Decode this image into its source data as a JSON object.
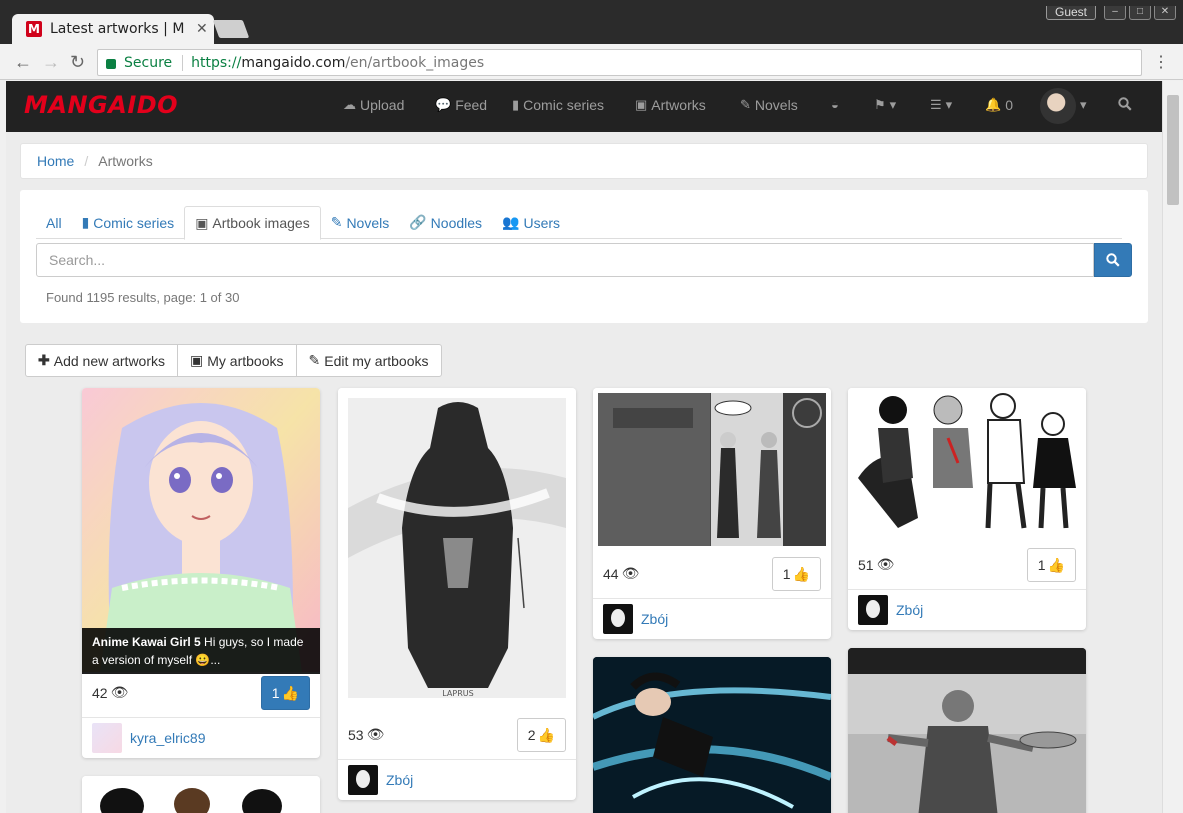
{
  "browser": {
    "tab_title": "Latest artworks | M",
    "tab_favicon": "M",
    "guest_label": "Guest",
    "secure_label": "Secure",
    "url_scheme": "https://",
    "url_host": "mangaido.com",
    "url_path": "/en/artbook_images"
  },
  "site": {
    "logo": "MANGAIDO",
    "nav": [
      {
        "label": "Upload",
        "icon": "cloud-upload-icon"
      },
      {
        "label": "Feed",
        "icon": "comments-icon"
      },
      {
        "label": "Comic series",
        "icon": "book-icon"
      },
      {
        "label": "Artworks",
        "icon": "picture-icon"
      },
      {
        "label": "Novels",
        "icon": "edit-icon"
      }
    ],
    "notif_count": "0",
    "brand_color": "#e3001b",
    "link_color": "#337ab7"
  },
  "breadcrumb": {
    "home": "Home",
    "current": "Artworks"
  },
  "filter_tabs": [
    {
      "label": "All",
      "icon": ""
    },
    {
      "label": "Comic series",
      "icon": "book-icon"
    },
    {
      "label": "Artbook images",
      "icon": "picture-icon"
    },
    {
      "label": "Novels",
      "icon": "edit-icon"
    },
    {
      "label": "Noodles",
      "icon": "link-icon"
    },
    {
      "label": "Users",
      "icon": "users-icon"
    }
  ],
  "search": {
    "placeholder": "Search...",
    "results": "Found 1195 results, page: 1 of 30"
  },
  "actions": {
    "add": "Add new artworks",
    "my": "My artbooks",
    "edit": "Edit my artbooks"
  },
  "cards": [
    {
      "views": "42",
      "likes": "1",
      "liked": true,
      "author": "kyra_elric89",
      "caption_title": "Anime Kawai Girl 5",
      "caption_text": " Hi guys, so I made a version of myself 😀..."
    },
    {
      "views": "53",
      "likes": "2",
      "liked": false,
      "author": "Zbój",
      "signature": "LAPRUS"
    },
    {
      "views": "44",
      "likes": "1",
      "liked": false,
      "author": "Zbój"
    },
    {
      "views": "51",
      "likes": "1",
      "liked": false,
      "author": "Zbój"
    }
  ]
}
